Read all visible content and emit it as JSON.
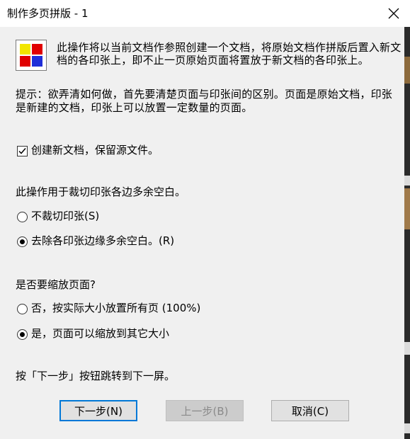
{
  "window": {
    "title": "制作多页拼版 - 1"
  },
  "colors": {
    "accent": "#0078d7",
    "icon_red": "#e00000",
    "icon_yellow": "#f2e600",
    "icon_blue": "#1f2ed8"
  },
  "icons": {
    "app": "imposition-grid-icon",
    "close": "close-icon",
    "check": "checkmark-icon"
  },
  "description": "此操作将以当前文档作参照创建一个文档，将原始文档作拼版后置入新文档的各印张上，即不止一页原始页面将置放于新文档的各印张上。",
  "hint": "提示：欲弄清如何做，首先要清楚页面与印张间的区别。页面是原始文档，印张是新建的文档，印张上可以放置一定数量的页面。",
  "create_new_doc": {
    "label": "创建新文档，保留源文件。",
    "checked": true
  },
  "trim_section": {
    "heading": "此操作用于裁切印张各边多余空白。",
    "options": [
      {
        "label": "不裁切印张(S)",
        "selected": false
      },
      {
        "label": "去除各印张边缘多余空白。(R)",
        "selected": true
      }
    ]
  },
  "scale_section": {
    "heading": "是否要缩放页面?",
    "options": [
      {
        "label": "否，按实际大小放置所有页 (100%)",
        "selected": false
      },
      {
        "label": "是，页面可以缩放到其它大小",
        "selected": true
      }
    ]
  },
  "footer_hint": "按「下一步」按钮跳转到下一屏。",
  "buttons": {
    "next": "下一步(N)",
    "back": "上一步(B)",
    "cancel": "取消(C)"
  }
}
